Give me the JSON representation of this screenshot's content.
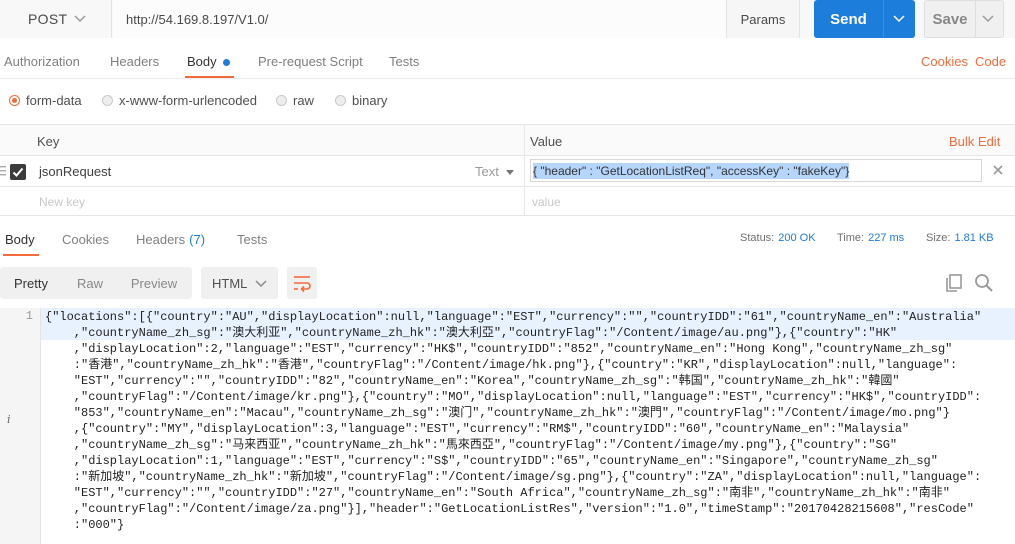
{
  "request": {
    "method": "POST",
    "url": "http://54.169.8.197/V1.0/",
    "params_label": "Params",
    "send_label": "Send",
    "save_label": "Save"
  },
  "request_tabs": {
    "authorization": "Authorization",
    "headers": "Headers",
    "body": "Body",
    "prerequest": "Pre-request Script",
    "tests": "Tests",
    "cookies_link": "Cookies",
    "code_link": "Code"
  },
  "body_types": {
    "form_data": "form-data",
    "urlencoded": "x-www-form-urlencoded",
    "raw": "raw",
    "binary": "binary"
  },
  "kv": {
    "key_header": "Key",
    "value_header": "Value",
    "bulk_edit": "Bulk Edit",
    "row": {
      "key": "jsonRequest",
      "type": "Text",
      "value": "{ \"header\" :  \"GetLocationListReq\",  \"accessKey\" : \"fakeKey\"}"
    },
    "new_key_placeholder": "New key",
    "new_value_placeholder": "value"
  },
  "response_tabs": {
    "body": "Body",
    "cookies": "Cookies",
    "headers": "Headers",
    "headers_count": "(7)",
    "tests": "Tests"
  },
  "status": {
    "status_label": "Status:",
    "status_value": "200 OK",
    "time_label": "Time:",
    "time_value": "227 ms",
    "size_label": "Size:",
    "size_value": "1.81 KB"
  },
  "view": {
    "pretty": "Pretty",
    "raw": "Raw",
    "preview": "Preview",
    "format": "HTML"
  },
  "editor": {
    "line_number": "1",
    "info_marker": "i",
    "lines": [
      "{\"locations\":[{\"country\":\"AU\",\"displayLocation\":null,\"language\":\"EST\",\"currency\":\"\",\"countryIDD\":\"61\",\"countryName_en\":\"Australia\"",
      "    ,\"countryName_zh_sg\":\"澳大利亚\",\"countryName_zh_hk\":\"澳大利亞\",\"countryFlag\":\"/Content/image/au.png\"},{\"country\":\"HK\"",
      "    ,\"displayLocation\":2,\"language\":\"EST\",\"currency\":\"HK$\",\"countryIDD\":\"852\",\"countryName_en\":\"Hong Kong\",\"countryName_zh_sg\"",
      "    :\"香港\",\"countryName_zh_hk\":\"香港\",\"countryFlag\":\"/Content/image/hk.png\"},{\"country\":\"KR\",\"displayLocation\":null,\"language\":",
      "    \"EST\",\"currency\":\"\",\"countryIDD\":\"82\",\"countryName_en\":\"Korea\",\"countryName_zh_sg\":\"韩国\",\"countryName_zh_hk\":\"韓國\"",
      "    ,\"countryFlag\":\"/Content/image/kr.png\"},{\"country\":\"MO\",\"displayLocation\":null,\"language\":\"EST\",\"currency\":\"HK$\",\"countryIDD\":",
      "    \"853\",\"countryName_en\":\"Macau\",\"countryName_zh_sg\":\"澳门\",\"countryName_zh_hk\":\"澳門\",\"countryFlag\":\"/Content/image/mo.png\"}",
      "    ,{\"country\":\"MY\",\"displayLocation\":3,\"language\":\"EST\",\"currency\":\"RM$\",\"countryIDD\":\"60\",\"countryName_en\":\"Malaysia\"",
      "    ,\"countryName_zh_sg\":\"马来西亚\",\"countryName_zh_hk\":\"馬來西亞\",\"countryFlag\":\"/Content/image/my.png\"},{\"country\":\"SG\"",
      "    ,\"displayLocation\":1,\"language\":\"EST\",\"currency\":\"S$\",\"countryIDD\":\"65\",\"countryName_en\":\"Singapore\",\"countryName_zh_sg\"",
      "    :\"新加坡\",\"countryName_zh_hk\":\"新加坡\",\"countryFlag\":\"/Content/image/sg.png\"},{\"country\":\"ZA\",\"displayLocation\":null,\"language\":",
      "    \"EST\",\"currency\":\"\",\"countryIDD\":\"27\",\"countryName_en\":\"South Africa\",\"countryName_zh_sg\":\"南非\",\"countryName_zh_hk\":\"南非\"",
      "    ,\"countryFlag\":\"/Content/image/za.png\"}],\"header\":\"GetLocationListRes\",\"version\":\"1.0\",\"timeStamp\":\"20170428215608\",\"resCode\"",
      "    :\"000\"}"
    ]
  },
  "colors": {
    "accent_orange": "#f26b3a",
    "accent_blue": "#1d7ddb"
  }
}
